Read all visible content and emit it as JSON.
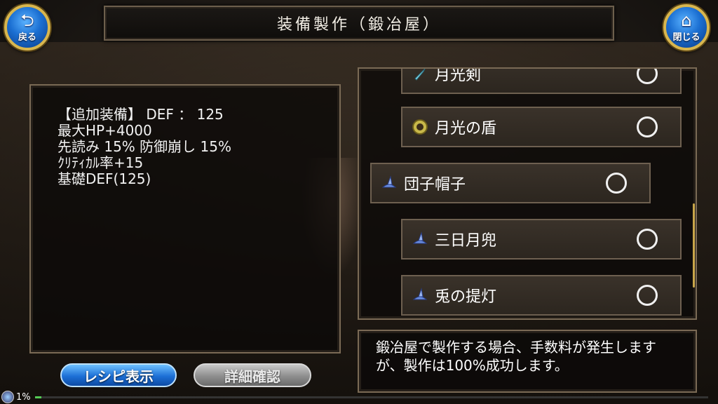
{
  "header": {
    "title": "装備製作（鍛冶屋）",
    "back_label": "戻る",
    "close_label": "閉じる"
  },
  "detail": {
    "lines": [
      "【追加装備】 DEF ： 125",
      "最大HP+4000",
      "先読み 15% 防御崩し 15%",
      "ｸﾘﾃｨｶﾙ率+15",
      "基礎DEF(125)"
    ]
  },
  "actions": {
    "recipe_label": "レシピ表示",
    "details_label": "詳細確認"
  },
  "list": {
    "items": [
      {
        "name": "月光剣",
        "icon": "sword-icon",
        "selected": false
      },
      {
        "name": "月光の盾",
        "icon": "shield-icon",
        "selected": false
      },
      {
        "name": "団子帽子",
        "icon": "hat-icon",
        "selected": false,
        "highlighted": true
      },
      {
        "name": "三日月兜",
        "icon": "hat-icon",
        "selected": false
      },
      {
        "name": "兎の提灯",
        "icon": "hat-icon",
        "selected": false
      }
    ]
  },
  "message": {
    "text": "鍛冶屋で製作する場合、手数料が発生しますが、製作は100%成功します。"
  },
  "status": {
    "percent_label": "1%",
    "progress": 0.01
  },
  "colors": {
    "accent_blue": "#1c6fd6",
    "gold_border": "#d8b64e",
    "panel_border": "#7a6a55"
  }
}
